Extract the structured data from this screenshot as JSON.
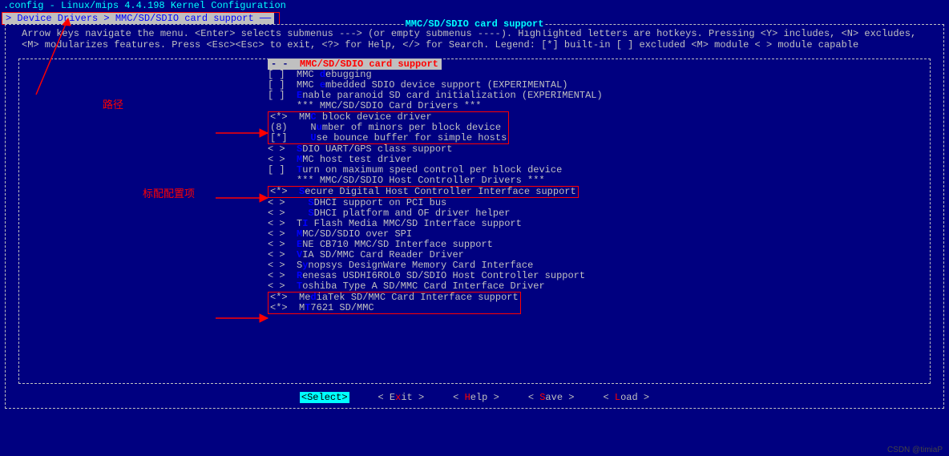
{
  "title": ".config - Linux/mips 4.4.198 Kernel Configuration",
  "breadcrumb": "> Device Drivers > MMC/SD/SDIO card support ──",
  "box_title": "MMC/SD/SDIO card support",
  "help1": "Arrow keys navigate the menu.  <Enter> selects submenus ---> (or empty submenus ----).  Highlighted letters are hotkeys.  Pressing <Y> includes, <N> excludes,",
  "help2": "<M> modularizes features.  Press <Esc><Esc> to exit, <?> for Help, </> for Search.  Legend: [*] built-in  [ ] excluded  <M> module  < > module capable",
  "current_sel": "- -",
  "current_label": "MMC/SD/SDIO card support",
  "items": [
    {
      "sel": "[ ]",
      "pre": "  MMC ",
      "hl": "d",
      "post": "ebugging"
    },
    {
      "sel": "[ ]",
      "pre": "  MMC ",
      "hl": "e",
      "post": "mbedded SDIO device support (EXPERIMENTAL)"
    },
    {
      "sel": "[ ]",
      "pre": "  ",
      "hl": "E",
      "post": "nable paranoid SD card initialization (EXPERIMENTAL)"
    },
    {
      "sel": "   ",
      "pre": "  *** MMC/SD/SDIO Card Drivers ***",
      "hl": "",
      "post": ""
    }
  ],
  "group1": [
    {
      "sel": "<*>",
      "pre": "  MM",
      "hl": "C",
      "post": " block device driver"
    },
    {
      "sel": "(8)",
      "pre": "    N",
      "hl": "u",
      "post": "mber of minors per block device"
    },
    {
      "sel": "[*]",
      "pre": "    ",
      "hl": "U",
      "post": "se bounce buffer for simple hosts"
    }
  ],
  "items2": [
    {
      "sel": "< >",
      "pre": "  ",
      "hl": "S",
      "post": "DIO UART/GPS class support"
    },
    {
      "sel": "< >",
      "pre": "  ",
      "hl": "M",
      "post": "MC host test driver"
    },
    {
      "sel": "[ ]",
      "pre": "  ",
      "hl": "T",
      "post": "urn on maximum speed control per block device"
    },
    {
      "sel": "   ",
      "pre": "  *** MMC/SD/SDIO Host Controller Drivers ***",
      "hl": "",
      "post": ""
    }
  ],
  "group2": [
    {
      "sel": "<*>",
      "pre": "  ",
      "hl": "S",
      "post": "ecure Digital Host Controller Interface support"
    }
  ],
  "items3": [
    {
      "sel": "< >",
      "pre": "    ",
      "hl": "S",
      "post": "DHCI support on PCI bus"
    },
    {
      "sel": "< >",
      "pre": "    ",
      "hl": "S",
      "post": "DHCI platform and OF driver helper"
    },
    {
      "sel": "< >",
      "pre": "  T",
      "hl": "I",
      "post": " Flash Media MMC/SD Interface support"
    },
    {
      "sel": "< >",
      "pre": "  ",
      "hl": "M",
      "post": "MC/SD/SDIO over SPI"
    },
    {
      "sel": "< >",
      "pre": "  ",
      "hl": "E",
      "post": "NE CB710 MMC/SD Interface support"
    },
    {
      "sel": "< >",
      "pre": "  ",
      "hl": "V",
      "post": "IA SD/MMC Card Reader Driver"
    },
    {
      "sel": "< >",
      "pre": "  S",
      "hl": "y",
      "post": "nopsys DesignWare Memory Card Interface"
    },
    {
      "sel": "< >",
      "pre": "  ",
      "hl": "R",
      "post": "enesas USDHI6ROL0 SD/SDIO Host Controller support"
    },
    {
      "sel": "< >",
      "pre": "  ",
      "hl": "T",
      "post": "oshiba Type A SD/MMC Card Interface Driver"
    }
  ],
  "group3": [
    {
      "sel": "<*>",
      "pre": "  Me",
      "hl": "d",
      "post": "iaTek SD/MMC Card Interface support"
    },
    {
      "sel": "<*>",
      "pre": "  M",
      "hl": "T",
      "post": "7621 SD/MMC"
    }
  ],
  "buttons": {
    "select": "<Select>",
    "exit_pre": "< E",
    "exit_hl": "x",
    "exit_post": "it >",
    "help_pre": "< ",
    "help_hl": "H",
    "help_post": "elp >",
    "save_pre": "< ",
    "save_hl": "S",
    "save_post": "ave >",
    "load_pre": "< ",
    "load_hl": "L",
    "load_post": "oad >"
  },
  "ann_path": "路径",
  "ann_std": "标配配置项",
  "watermark": "CSDN @timiaP"
}
